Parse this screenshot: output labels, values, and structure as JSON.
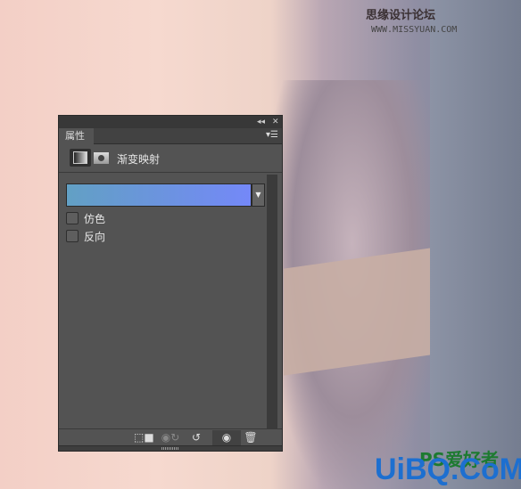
{
  "watermarks": {
    "top_cn": "思缘设计论坛",
    "top_url": "WWW.MISSYUAN.COM",
    "bottom_ps": "PS爱好者",
    "bottom_brand": "UiBQ.CoM"
  },
  "panel": {
    "tab_label": "属性",
    "adjustment_title": "渐变映射",
    "gradient": {
      "start_color": "#62a0c4",
      "end_color": "#7488f8"
    },
    "checkboxes": [
      {
        "label": "仿色",
        "checked": false
      },
      {
        "label": "反向",
        "checked": false
      }
    ],
    "toolbar_icons": [
      "clip-to-layer-icon",
      "view-previous-state-icon",
      "reset-icon",
      "visibility-eye-icon",
      "trash-icon"
    ]
  }
}
